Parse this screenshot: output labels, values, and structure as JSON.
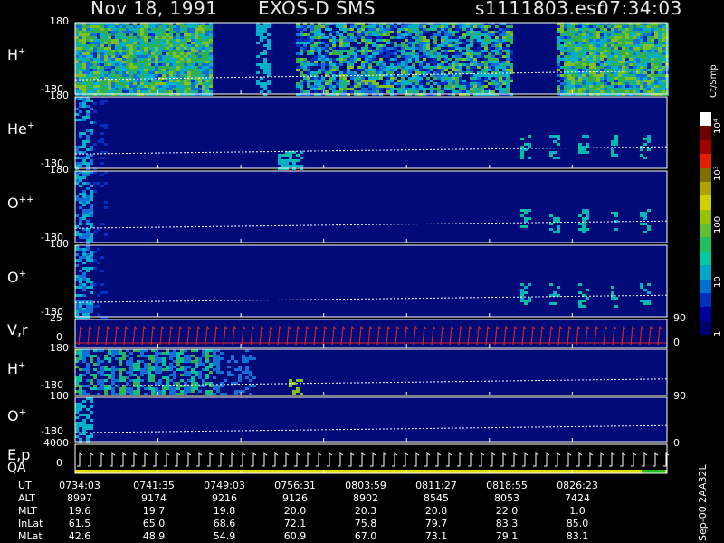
{
  "header": {
    "date": "Nov 18, 1991",
    "instrument": "EXOS-D SMS",
    "file": "s1111803.esr",
    "time": "07:34:03"
  },
  "panels": [
    {
      "label": "H",
      "sup": "+",
      "ytop": "180",
      "ybot": "-180",
      "right_ticks": []
    },
    {
      "label": "He",
      "sup": "+",
      "ytop": "180",
      "ybot": "-180",
      "right_ticks": []
    },
    {
      "label": "O",
      "sup": "++",
      "ytop": "180",
      "ybot": "-180",
      "right_ticks": []
    },
    {
      "label": "O",
      "sup": "+",
      "ytop": "180",
      "ybot": "-180",
      "right_ticks": []
    },
    {
      "label": "V,r",
      "sup": "",
      "ytop": "25",
      "ybot": "0",
      "right_ticks": [
        "90",
        "0"
      ]
    },
    {
      "label": "H",
      "sup": "+",
      "ytop": "180",
      "ybot": "-180",
      "right_ticks": []
    },
    {
      "label": "O",
      "sup": "+",
      "ytop": "180",
      "ybot": "-180",
      "right_ticks": [
        "90"
      ]
    },
    {
      "label": "E,p",
      "sup": "",
      "label2": "QA",
      "ytop": "4000",
      "ybot": "0",
      "right_ticks": [
        "0"
      ]
    }
  ],
  "colorbar": {
    "unit": "Ct/Smp",
    "ticks": [
      "1",
      "10",
      "100",
      "10³",
      "10⁴"
    ],
    "colors": [
      "#000070",
      "#0000a0",
      "#0030c0",
      "#0070d0",
      "#00a8c8",
      "#00c8a0",
      "#20c060",
      "#60c030",
      "#98c000",
      "#d0d000",
      "#b0a000",
      "#807000",
      "#e02000",
      "#a00000",
      "#700000",
      "#ffffff"
    ]
  },
  "footer": {
    "version": "Sep-00 2AA32L"
  },
  "table": {
    "rows": [
      {
        "label": "UT",
        "values": [
          "0734:03",
          "0741:35",
          "0749:03",
          "0756:31",
          "0803:59",
          "0811:27",
          "0818:55",
          "0826:23"
        ]
      },
      {
        "label": "ALT",
        "values": [
          "8997",
          "9174",
          "9216",
          "9126",
          "8902",
          "8545",
          "8053",
          "7424"
        ]
      },
      {
        "label": "MLT",
        "values": [
          "19.6",
          "19.7",
          "19.8",
          "20.0",
          "20.3",
          "20.8",
          "22.0",
          "1.0"
        ]
      },
      {
        "label": "InLat",
        "values": [
          "61.5",
          "65.0",
          "68.6",
          "72.1",
          "75.8",
          "79.7",
          "83.3",
          "85.0"
        ]
      },
      {
        "label": "MLat",
        "values": [
          "42.6",
          "48.9",
          "54.9",
          "60.9",
          "67.0",
          "73.1",
          "79.1",
          "83.1"
        ]
      }
    ]
  },
  "chart_data": {
    "type": "heatmap",
    "title": "Nov 18, 1991 EXOS-D SMS s1111803.esr 07:34:03",
    "x": [
      "0734:03",
      "0741:35",
      "0749:03",
      "0756:31",
      "0803:59",
      "0811:27",
      "0818:55",
      "0826:23"
    ],
    "colorbar_unit": "Ct/Smp",
    "colorbar_ticks": [
      "1",
      "10",
      "100",
      "10³",
      "10⁴"
    ],
    "series": [
      {
        "name": "H+",
        "yrange": [
          -180,
          180
        ]
      },
      {
        "name": "He+",
        "yrange": [
          -180,
          180
        ]
      },
      {
        "name": "O++",
        "yrange": [
          -180,
          180
        ]
      },
      {
        "name": "O+",
        "yrange": [
          -180,
          180
        ]
      },
      {
        "name": "V,r",
        "yrange": [
          0,
          25
        ]
      },
      {
        "name": "H+",
        "yrange": [
          -180,
          180
        ]
      },
      {
        "name": "O+",
        "yrange": [
          -180,
          180
        ]
      },
      {
        "name": "E,p",
        "yrange": [
          0,
          4000
        ]
      }
    ]
  }
}
